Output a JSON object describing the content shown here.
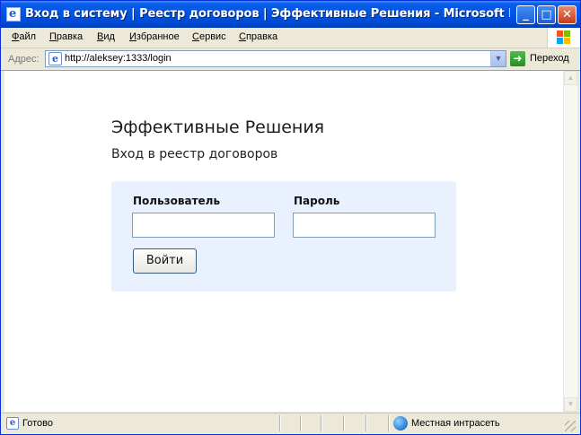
{
  "window": {
    "title": "Вход в систему | Реестр договоров | Эффективные Решения - Microsoft Internet E...",
    "buttons": {
      "minimize": "_",
      "maximize": "□",
      "close": "✕"
    }
  },
  "menu": [
    "Файл",
    "Правка",
    "Вид",
    "Избранное",
    "Сервис",
    "Справка"
  ],
  "address_bar": {
    "label": "Адрес:",
    "url": "http://aleksey:1333/login",
    "go_label": "Переход"
  },
  "page": {
    "brand": "Эффективные Решения",
    "subtitle": "Вход в реестр договоров",
    "login": {
      "username_label": "Пользователь",
      "username_value": "",
      "password_label": "Пароль",
      "password_value": "",
      "submit_label": "Войти"
    }
  },
  "status_bar": {
    "text": "Готово",
    "zone": "Местная интрасеть"
  },
  "colors": {
    "titlebar": "#0054e3",
    "panel_bg": "#e8f1fd",
    "chrome": "#ece9d8"
  }
}
